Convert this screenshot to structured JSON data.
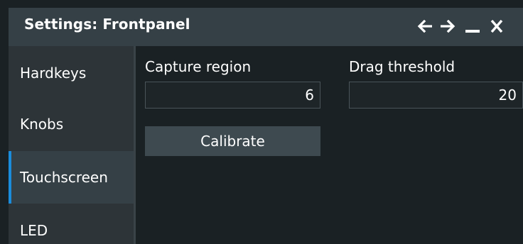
{
  "window": {
    "title": "Settings: Frontpanel",
    "controls": [
      {
        "icon": "arrow-left-icon"
      },
      {
        "icon": "arrow-right-icon"
      },
      {
        "icon": "minimize-icon"
      },
      {
        "icon": "close-icon"
      }
    ]
  },
  "sidebar": {
    "items": [
      {
        "label": "Hardkeys",
        "active": false
      },
      {
        "label": "Knobs",
        "active": false
      },
      {
        "label": "Touchscreen",
        "active": true
      },
      {
        "label": "LED",
        "active": false
      }
    ]
  },
  "content": {
    "capture_region": {
      "label": "Capture region",
      "value": "6"
    },
    "drag_threshold": {
      "label": "Drag threshold",
      "value": "20"
    },
    "calibrate_label": "Calibrate"
  },
  "colors": {
    "accent": "#1a8cdc",
    "titlebar": "#354046",
    "background": "#1a2124"
  }
}
